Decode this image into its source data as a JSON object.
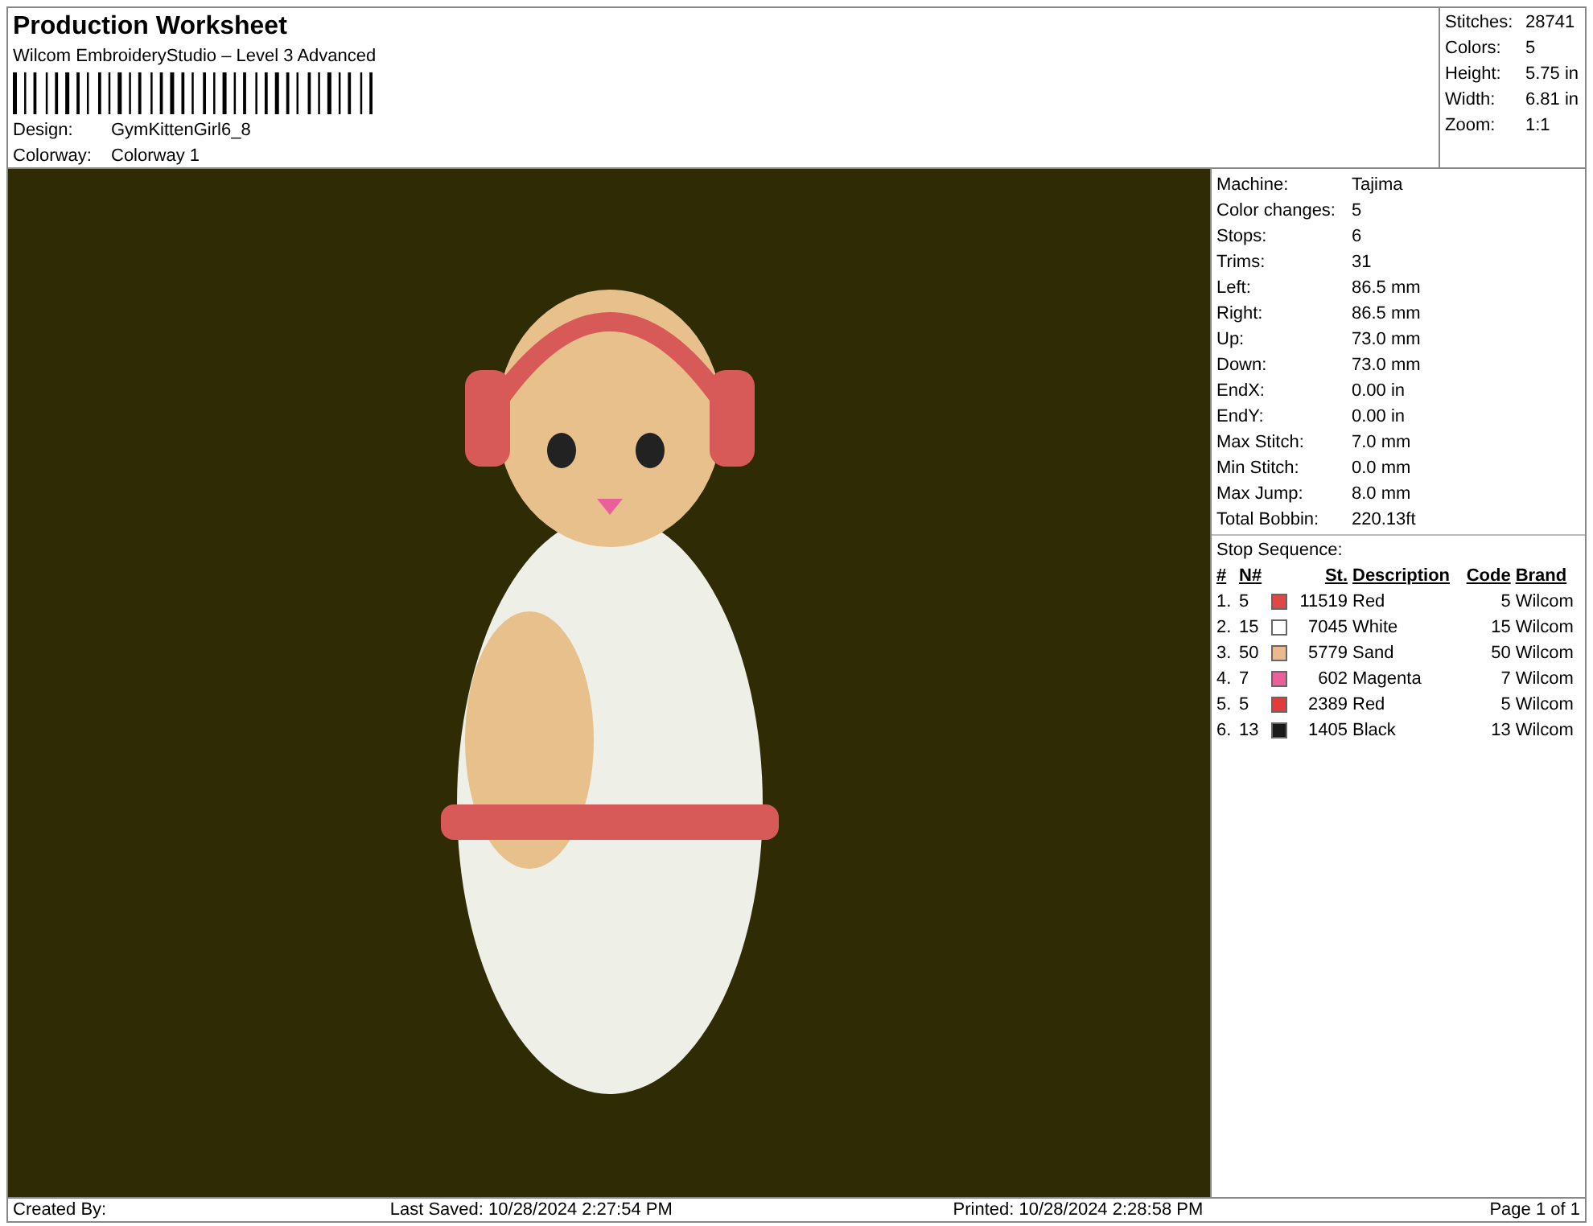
{
  "header": {
    "title": "Production Worksheet",
    "subtitle": "Wilcom EmbroideryStudio – Level 3 Advanced",
    "fields": [
      {
        "label": "Design:",
        "value": "GymKittenGirl6_8"
      },
      {
        "label": "Colorway:",
        "value": "Colorway 1"
      }
    ]
  },
  "summary": [
    {
      "label": "Stitches:",
      "value": "28741"
    },
    {
      "label": "Colors:",
      "value": "5"
    },
    {
      "label": "Height:",
      "value": "5.75 in"
    },
    {
      "label": "Width:",
      "value": "6.81 in"
    },
    {
      "label": "Zoom:",
      "value": "1:1"
    }
  ],
  "machine_info": [
    {
      "label": "Machine:",
      "value": "Tajima"
    },
    {
      "label": "Color changes:",
      "value": "5"
    },
    {
      "label": "Stops:",
      "value": "6"
    },
    {
      "label": "Trims:",
      "value": "31"
    },
    {
      "label": "Left:",
      "value": "86.5 mm"
    },
    {
      "label": "Right:",
      "value": "86.5 mm"
    },
    {
      "label": "Up:",
      "value": "73.0 mm"
    },
    {
      "label": "Down:",
      "value": "73.0 mm"
    },
    {
      "label": "EndX:",
      "value": "0.00 in"
    },
    {
      "label": "EndY:",
      "value": "0.00 in"
    },
    {
      "label": "Max Stitch:",
      "value": "7.0 mm"
    },
    {
      "label": "Min Stitch:",
      "value": "0.0 mm"
    },
    {
      "label": "Max Jump:",
      "value": "8.0 mm"
    },
    {
      "label": "Total Bobbin:",
      "value": "220.13ft"
    }
  ],
  "stop_sequence": {
    "title": "Stop Sequence:",
    "columns": [
      "#",
      "N#",
      "St.",
      "Description",
      "Code",
      "Brand"
    ],
    "rows": [
      {
        "index": "1.",
        "needle": "5",
        "color": "#e04848",
        "stitches": "11519",
        "description": "Red",
        "code": "5",
        "brand": "Wilcom"
      },
      {
        "index": "2.",
        "needle": "15",
        "color": "#ffffff",
        "stitches": "7045",
        "description": "White",
        "code": "15",
        "brand": "Wilcom"
      },
      {
        "index": "3.",
        "needle": "50",
        "color": "#eab98c",
        "stitches": "5779",
        "description": "Sand",
        "code": "50",
        "brand": "Wilcom"
      },
      {
        "index": "4.",
        "needle": "7",
        "color": "#ea609a",
        "stitches": "602",
        "description": "Magenta",
        "code": "7",
        "brand": "Wilcom"
      },
      {
        "index": "5.",
        "needle": "5",
        "color": "#e03c3c",
        "stitches": "2389",
        "description": "Red",
        "code": "5",
        "brand": "Wilcom"
      },
      {
        "index": "6.",
        "needle": "13",
        "color": "#1a1a1a",
        "stitches": "1405",
        "description": "Black",
        "code": "13",
        "brand": "Wilcom"
      }
    ]
  },
  "footer": {
    "created_by": "Created By:",
    "last_saved": "Last Saved: 10/28/2024 2:27:54 PM",
    "printed": "Printed: 10/28/2024 2:28:58 PM",
    "page": "Page 1 of 1"
  }
}
